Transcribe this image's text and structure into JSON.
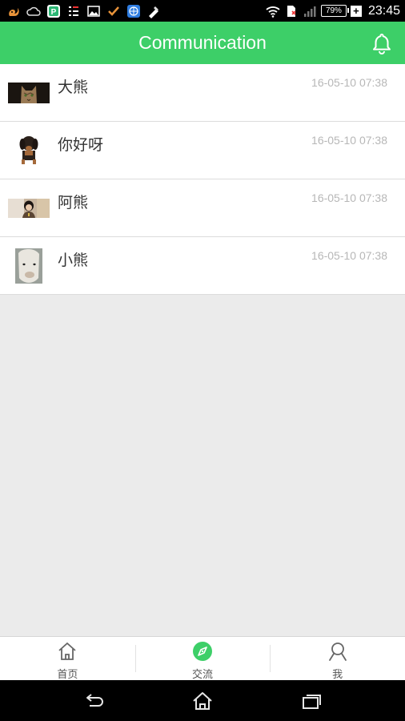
{
  "status_bar": {
    "time": "23:45",
    "battery_percent": "79%",
    "charging_symbol": "+",
    "left_icons": [
      "squirrel-icon",
      "cloud-icon",
      "green-p-app-icon",
      "checklist-icon",
      "image-icon",
      "check-mark-icon",
      "globe-app-icon",
      "tools-icon"
    ],
    "right_icons": [
      "wifi-icon",
      "sim-icon",
      "signal-icon",
      "battery-icon"
    ]
  },
  "header": {
    "title": "Communication",
    "bell_icon": "bell-icon",
    "accent_color": "#3dcf68"
  },
  "conversations": [
    {
      "name": "大熊",
      "time": "16-05-10 07:38",
      "avatar": "cat-photo"
    },
    {
      "name": "你好呀",
      "time": "16-05-10 07:38",
      "avatar": "dog-photo"
    },
    {
      "name": "阿熊",
      "time": "16-05-10 07:38",
      "avatar": "person-photo"
    },
    {
      "name": "小熊",
      "time": "16-05-10 07:38",
      "avatar": "llama-photo"
    }
  ],
  "tabs": [
    {
      "label": "首页",
      "icon": "home-icon",
      "active": false
    },
    {
      "label": "交流",
      "icon": "compass-icon",
      "active": true
    },
    {
      "label": "我",
      "icon": "person-icon",
      "active": false
    }
  ],
  "nav_bar": {
    "buttons": [
      "back-icon",
      "home-nav-icon",
      "recent-apps-icon"
    ]
  }
}
